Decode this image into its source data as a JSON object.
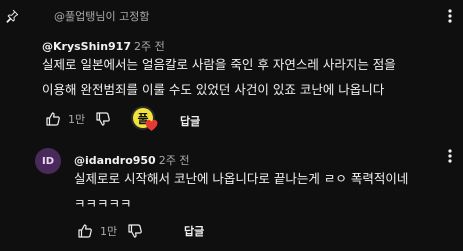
{
  "pinned": {
    "label": "@풀업탱님이 고정함"
  },
  "comment": {
    "author": "@KrysShin917",
    "time": "2주 전",
    "lines": [
      "실제로 일본에서는 얼음칼로 사람을 죽인 후 자연스레 사라지는 점을",
      "이용해 완전범죄를 이룰 수도 있었던 사건이 있죠 코난에 나옵니다"
    ],
    "likes": "1만",
    "reply_label": "답글",
    "creator_avatar_glyph": "풀"
  },
  "reply": {
    "avatar_initials": "ID",
    "author": "@idandro950",
    "time": "2주 전",
    "lines": [
      "실제로로 시작해서 코난에 나옵니다로 끝나는게 ㄹㅇ 폭력적이네",
      "ㅋㅋㅋㅋㅋ"
    ],
    "likes": "1만",
    "reply_label": "답글"
  },
  "colors": {
    "background": "#0f0f0f",
    "secondary_text": "#aaaaaa",
    "heart": "#e53935",
    "creator_avatar": "#f2e33a",
    "reply_avatar": "#4a2a5a"
  }
}
